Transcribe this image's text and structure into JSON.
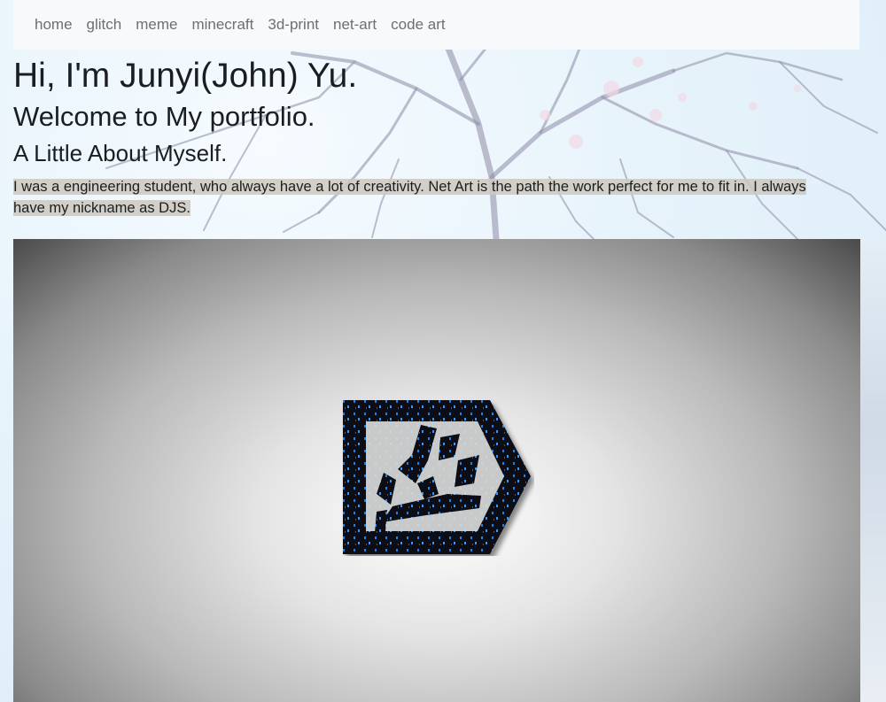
{
  "nav": {
    "items": [
      {
        "label": "home"
      },
      {
        "label": "glitch"
      },
      {
        "label": "meme"
      },
      {
        "label": "minecraft"
      },
      {
        "label": "3d-print"
      },
      {
        "label": "net-art"
      },
      {
        "label": "code art"
      }
    ]
  },
  "main": {
    "title": "Hi, I'm Junyi(John) Yu.",
    "subtitle": "Welcome to My portfolio.",
    "about_heading": "A Little About Myself.",
    "bio": "I was a engineering student, who always have a lot of creativity. Net Art is the path the work perfect for me to fit in. I always have my nickname as DJS."
  },
  "colors": {
    "navbar_bg": "#f8f9fa",
    "nav_text": "#6c6f73",
    "logo_accent": "#2b7fd8"
  },
  "hero": {
    "logo_icon": "djs-logo-icon"
  }
}
